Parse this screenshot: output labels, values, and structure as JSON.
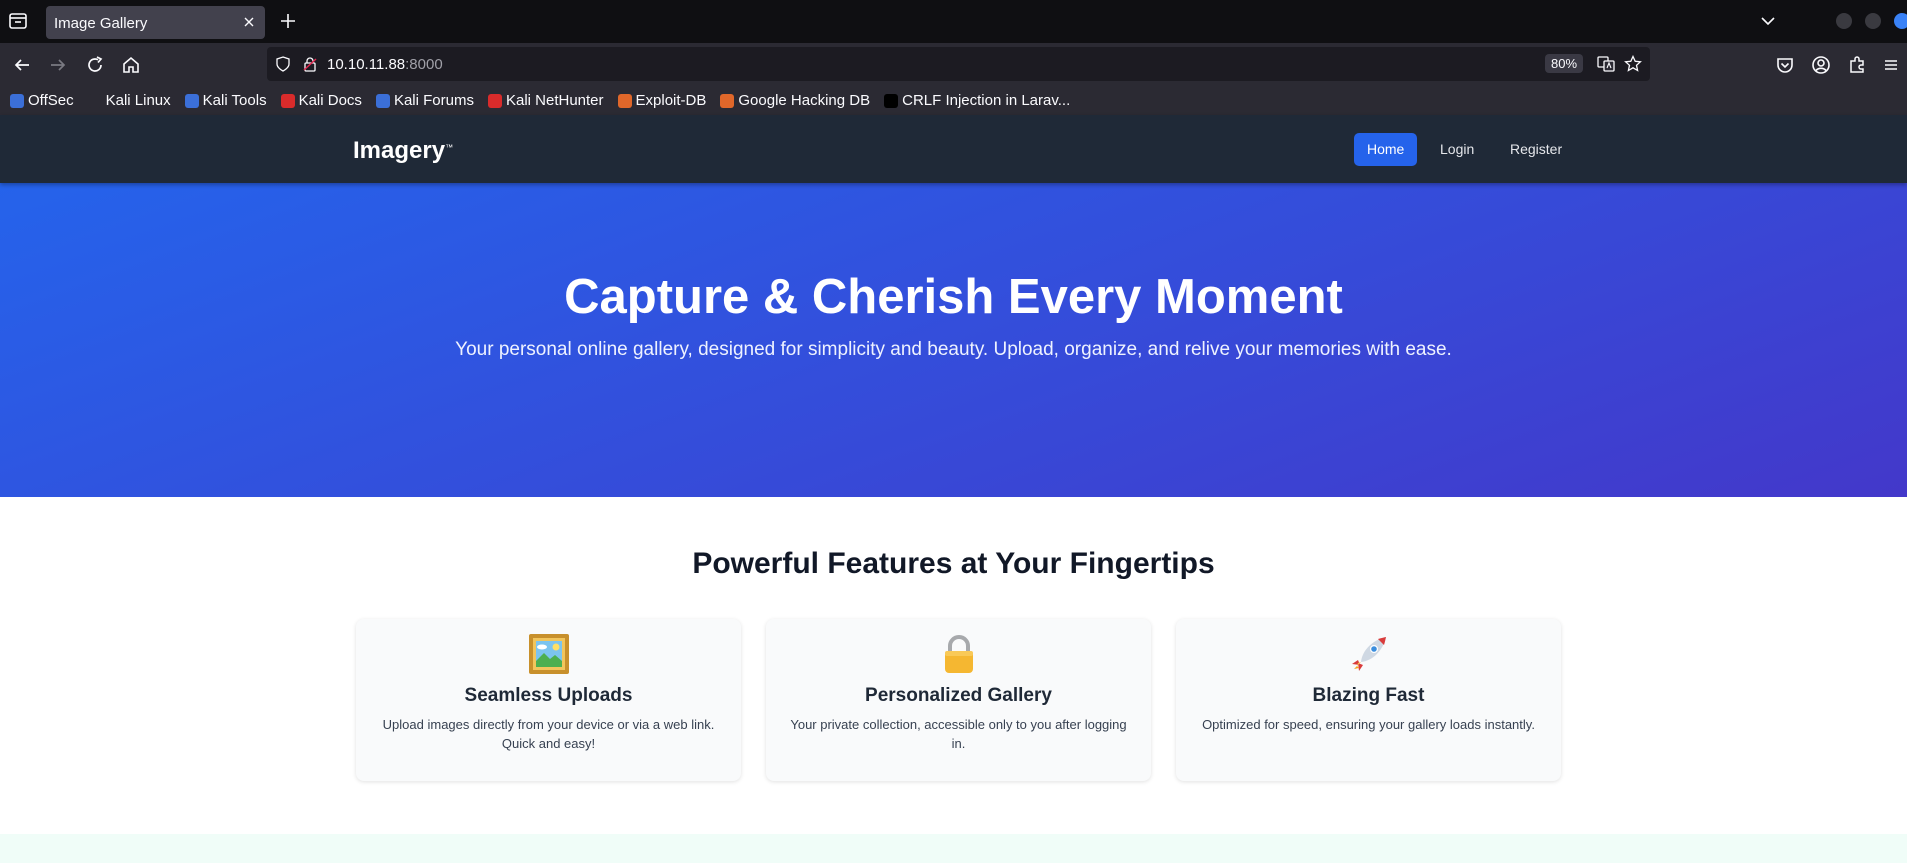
{
  "browser": {
    "tab_title": "Image Gallery",
    "url_host": "10.10.11.88",
    "url_port": ":8000",
    "zoom": "80%",
    "bookmarks": [
      {
        "label": "OffSec",
        "color": "#3b6fd8"
      },
      {
        "label": "Kali Linux",
        "color": "#2b2a33"
      },
      {
        "label": "Kali Tools",
        "color": "#3b6fd8"
      },
      {
        "label": "Kali Docs",
        "color": "#d92b2b"
      },
      {
        "label": "Kali Forums",
        "color": "#3b6fd8"
      },
      {
        "label": "Kali NetHunter",
        "color": "#d92b2b"
      },
      {
        "label": "Exploit-DB",
        "color": "#e0672a"
      },
      {
        "label": "Google Hacking DB",
        "color": "#e0672a"
      },
      {
        "label": "CRLF Injection in Larav...",
        "color": "#000000"
      }
    ]
  },
  "site": {
    "logo": "Imagery",
    "logo_tm": "™",
    "nav": {
      "home": "Home",
      "login": "Login",
      "register": "Register"
    },
    "accent": "#2563eb"
  },
  "hero": {
    "title": "Capture & Cherish Every Moment",
    "subtitle": "Your personal online gallery, designed for simplicity and beauty. Upload, organize, and relive your memories with ease."
  },
  "features": {
    "title": "Powerful Features at Your Fingertips",
    "cards": [
      {
        "icon": "framed-picture-icon",
        "title": "Seamless Uploads",
        "desc": "Upload images directly from your device or via a web link. Quick and easy!"
      },
      {
        "icon": "lock-icon",
        "title": "Personalized Gallery",
        "desc": "Your private collection, accessible only to you after logging in."
      },
      {
        "icon": "rocket-icon",
        "title": "Blazing Fast",
        "desc": "Optimized for speed, ensuring your gallery loads instantly."
      }
    ]
  }
}
